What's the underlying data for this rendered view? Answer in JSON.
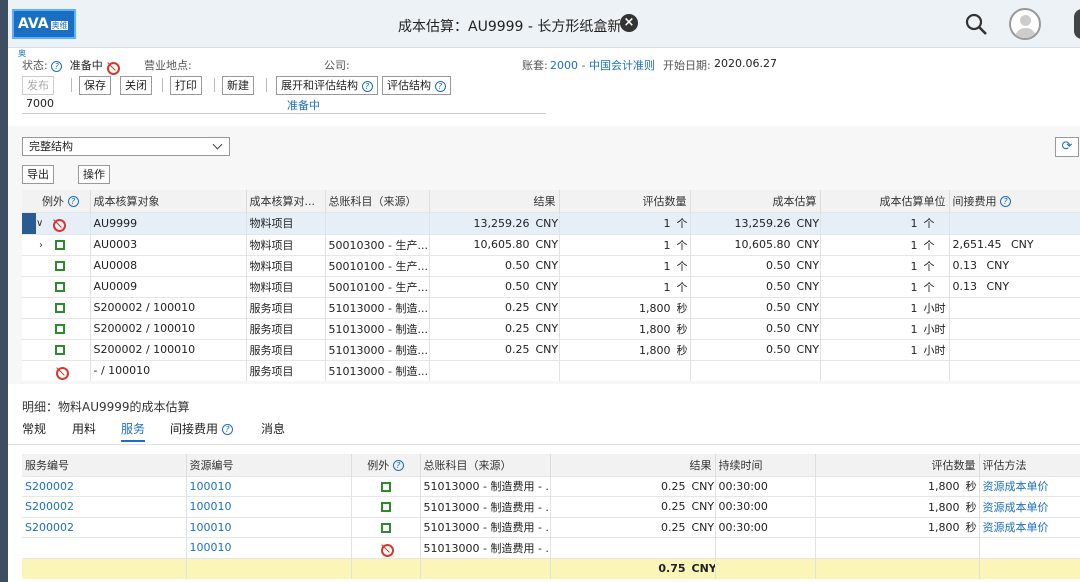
{
  "header": {
    "logo_text": "AVA",
    "logo_sub": "奥维奥",
    "title": "成本估算：AU9999 - 长方形纸盒新"
  },
  "info": {
    "status_label": "状态:",
    "status_value": "准备中",
    "site_label": "营业地点:",
    "company_label": "公司:",
    "ledger_label": "账套:",
    "ledger_value": "2000 - 中国会计准则",
    "start_label": "开始日期:",
    "start_value": "2020.06.27"
  },
  "toolbar": {
    "publish": "发布",
    "save": "保存",
    "close": "关闭",
    "print": "打印",
    "new": "新建",
    "expand_eval": "展开和评估结构",
    "eval_structure": "评估结构"
  },
  "partial_row": {
    "left": "7000",
    "right": "准备中"
  },
  "structure_select": "完整结构",
  "table_actions": {
    "export": "导出",
    "actions": "操作"
  },
  "tree": {
    "headers": [
      "例外",
      "成本核算对象",
      "成本核算对...",
      "总账科目（来源）",
      "结果",
      "评估数量",
      "成本估算",
      "成本估算单位",
      "间接费用"
    ],
    "rows": [
      {
        "obj": "AU9999",
        "type": "物料项目",
        "gl": "",
        "result": "13,259.26",
        "cur": "CNY",
        "qty": "1",
        "qty_unit": "个",
        "est": "13,259.26",
        "est_cur": "CNY",
        "unit": "1",
        "unit_u": "个",
        "ind": "",
        "ind_cur": "",
        "icon": "exception",
        "caret": "∨",
        "sel": true
      },
      {
        "obj": "AU0003",
        "type": "物料项目",
        "gl": "50010300 - 生产...",
        "result": "10,605.80",
        "cur": "CNY",
        "qty": "1",
        "qty_unit": "个",
        "est": "10,605.80",
        "est_cur": "CNY",
        "unit": "1",
        "unit_u": "个",
        "ind": "2,651.45",
        "ind_cur": "CNY",
        "icon": "ok",
        "caret": "›",
        "sel": false
      },
      {
        "obj": "AU0008",
        "type": "物料项目",
        "gl": "50010100 - 生产...",
        "result": "0.50",
        "cur": "CNY",
        "qty": "1",
        "qty_unit": "个",
        "est": "0.50",
        "est_cur": "CNY",
        "unit": "1",
        "unit_u": "个",
        "ind": "0.13",
        "ind_cur": "CNY",
        "icon": "ok",
        "caret": "",
        "sel": false
      },
      {
        "obj": "AU0009",
        "type": "物料项目",
        "gl": "50010100 - 生产...",
        "result": "0.50",
        "cur": "CNY",
        "qty": "1",
        "qty_unit": "个",
        "est": "0.50",
        "est_cur": "CNY",
        "unit": "1",
        "unit_u": "个",
        "ind": "0.13",
        "ind_cur": "CNY",
        "icon": "ok",
        "caret": "",
        "sel": false
      },
      {
        "obj": "S200002 / 100010",
        "type": "服务项目",
        "gl": "51013000 - 制造...",
        "result": "0.25",
        "cur": "CNY",
        "qty": "1,800",
        "qty_unit": "秒",
        "est": "0.50",
        "est_cur": "CNY",
        "unit": "1",
        "unit_u": "小时",
        "ind": "",
        "ind_cur": "",
        "icon": "ok",
        "caret": "",
        "sel": false
      },
      {
        "obj": "S200002 / 100010",
        "type": "服务项目",
        "gl": "51013000 - 制造...",
        "result": "0.25",
        "cur": "CNY",
        "qty": "1,800",
        "qty_unit": "秒",
        "est": "0.50",
        "est_cur": "CNY",
        "unit": "1",
        "unit_u": "小时",
        "ind": "",
        "ind_cur": "",
        "icon": "ok",
        "caret": "",
        "sel": false
      },
      {
        "obj": "S200002 / 100010",
        "type": "服务项目",
        "gl": "51013000 - 制造...",
        "result": "0.25",
        "cur": "CNY",
        "qty": "1,800",
        "qty_unit": "秒",
        "est": "0.50",
        "est_cur": "CNY",
        "unit": "1",
        "unit_u": "小时",
        "ind": "",
        "ind_cur": "",
        "icon": "ok",
        "caret": "",
        "sel": false
      },
      {
        "obj": "- / 100010",
        "type": "服务项目",
        "gl": "51013000 - 制造...",
        "result": "",
        "cur": "",
        "qty": "",
        "qty_unit": "",
        "est": "",
        "est_cur": "",
        "unit": "",
        "unit_u": "",
        "ind": "",
        "ind_cur": "",
        "icon": "exception",
        "caret": "",
        "sel": false
      }
    ]
  },
  "detail": {
    "title": "明细：物料AU9999的成本估算",
    "tabs": [
      "常规",
      "用料",
      "服务",
      "间接费用",
      "消息"
    ],
    "active_tab": 2
  },
  "services": {
    "headers": [
      "服务编号",
      "资源编号",
      "例外",
      "总账科目（来源）",
      "结果",
      "持续时间",
      "评估数量",
      "评估方法"
    ],
    "rows": [
      {
        "svc": "S200002",
        "res": "100010",
        "icon": "ok",
        "gl": "51013000 - 制造费用 - ...",
        "result": "0.25",
        "cur": "CNY",
        "dur": "00:30:00",
        "qty": "1,800",
        "qu": "秒",
        "method": "资源成本单价"
      },
      {
        "svc": "S200002",
        "res": "100010",
        "icon": "ok",
        "gl": "51013000 - 制造费用 - ...",
        "result": "0.25",
        "cur": "CNY",
        "dur": "00:30:00",
        "qty": "1,800",
        "qu": "秒",
        "method": "资源成本单价"
      },
      {
        "svc": "S200002",
        "res": "100010",
        "icon": "ok",
        "gl": "51013000 - 制造费用 - ...",
        "result": "0.25",
        "cur": "CNY",
        "dur": "00:30:00",
        "qty": "1,800",
        "qu": "秒",
        "method": "资源成本单价"
      },
      {
        "svc": "",
        "res": "100010",
        "icon": "exception",
        "gl": "51013000 - 制造费用 - ...",
        "result": "",
        "cur": "",
        "dur": "",
        "qty": "",
        "qu": "",
        "method": ""
      }
    ],
    "total": {
      "result": "0.75",
      "cur": "CNY"
    }
  },
  "colors": {
    "link": "#1a6fc4",
    "ok": "#2d8a2d",
    "exception": "#d43a2d",
    "total_bg": "#fbf5b8"
  },
  "icons": [
    "help-icon",
    "exception-icon",
    "ok-status-icon",
    "search-icon",
    "close-icon",
    "refresh-icon",
    "avatar"
  ]
}
